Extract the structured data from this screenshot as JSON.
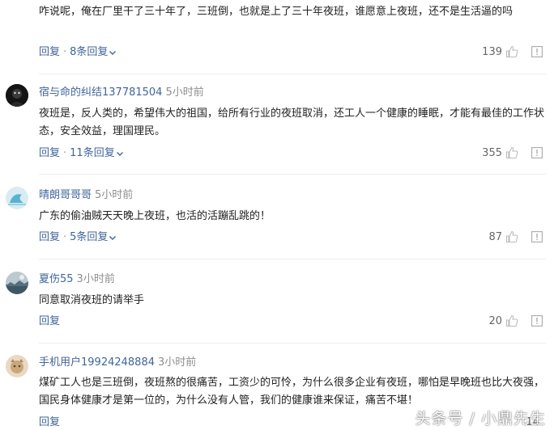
{
  "comments": [
    {
      "user": "",
      "time": "",
      "text": "咋说呢，俺在厂里干了三十年了，三班倒，也就是上了三十年夜班，谁愿意上夜班，还不是生活逼的吗",
      "reply_label": "回复",
      "replies_label": "8条回复",
      "likes": "139"
    },
    {
      "user": "宿与命的纠结137781504",
      "time": "5小时前",
      "text": "夜班是，反人类的，希望伟大的祖国，给所有行业的夜班取消，还工人一个健康的睡眠，才能有最佳的工作状态，安全效益，理国理民。",
      "reply_label": "回复",
      "replies_label": "11条回复",
      "likes": "355"
    },
    {
      "user": "晴朗哥哥哥",
      "time": "5小时前",
      "text": "广东的偷油贼天天晚上夜班，也活的活蹦乱跳的！",
      "reply_label": "回复",
      "replies_label": "5条回复",
      "likes": "87"
    },
    {
      "user": "夏伤55",
      "time": "3小时前",
      "text": "同意取消夜班的请举手",
      "reply_label": "回复",
      "replies_label": "",
      "likes": "20"
    },
    {
      "user": "手机用户19924248884",
      "time": "3小时前",
      "text": "煤矿工人也是三班倒，夜班熬的很痛苦，工资少的可怜，为什么很多企业有夜班，哪怕是早晚班也比大夜强，国民身体健康才是第一位的，为什么没有人管，我们的健康谁来保证，痛苦不堪！",
      "reply_label": "回复",
      "replies_label": "",
      "likes": "14"
    }
  ],
  "watermark": "头条号 / 小鼎先生",
  "colors": {
    "link": "#406599",
    "meta": "#8e8e8e",
    "text": "#222222"
  },
  "icons": {
    "like": "thumbs-up-icon",
    "report": "report-icon",
    "expand": "chevron-down-icon"
  }
}
